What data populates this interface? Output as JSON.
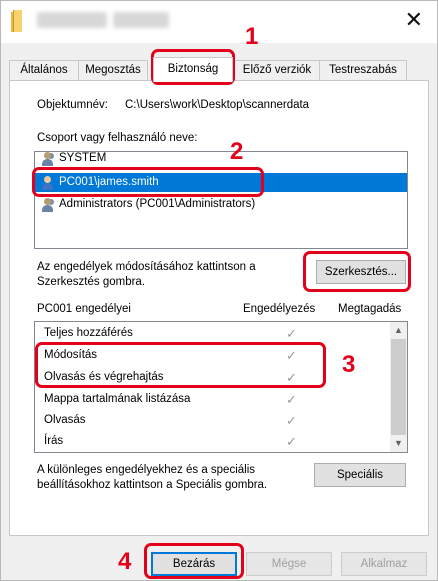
{
  "window": {
    "close_glyph": "✕"
  },
  "tabs": [
    {
      "label": "Általános",
      "active": false
    },
    {
      "label": "Megosztás",
      "active": false
    },
    {
      "label": "Biztonság",
      "active": true
    },
    {
      "label": "Előző verziók",
      "active": false
    },
    {
      "label": "Testreszabás",
      "active": false
    }
  ],
  "object": {
    "label": "Objektumnév:",
    "path": "C:\\Users\\work\\Desktop\\scannerdata"
  },
  "groups": {
    "label": "Csoport vagy felhasználó neve:",
    "items": [
      {
        "name": "SYSTEM",
        "icon": "users-group-icon",
        "selected": false
      },
      {
        "name": "PC001\\james.smith",
        "icon": "user-icon",
        "selected": true
      },
      {
        "name": "Administrators (PC001\\Administrators)",
        "icon": "users-group-icon",
        "selected": false
      }
    ]
  },
  "edit": {
    "hint": "Az engedélyek módosításához kattintson a Szerkesztés gombra.",
    "button": "Szerkesztés..."
  },
  "permissions": {
    "header": "PC001 engedélyei",
    "allow_col": "Engedélyezés",
    "deny_col": "Megtagadás",
    "rows": [
      {
        "name": "Teljes hozzáférés",
        "allow": true,
        "deny": false
      },
      {
        "name": "Módosítás",
        "allow": true,
        "deny": false
      },
      {
        "name": "Olvasás és végrehajtás",
        "allow": true,
        "deny": false
      },
      {
        "name": "Mappa tartalmának listázása",
        "allow": true,
        "deny": false
      },
      {
        "name": "Olvasás",
        "allow": true,
        "deny": false
      },
      {
        "name": "Írás",
        "allow": true,
        "deny": false
      }
    ],
    "check_glyph": "✓"
  },
  "special": {
    "hint": "A különleges engedélyekhez és a speciális beállításokhoz kattintson a Speciális gombra.",
    "button": "Speciális"
  },
  "footer": {
    "close": "Bezárás",
    "cancel": "Mégse",
    "apply": "Alkalmaz"
  },
  "annotations": [
    "1",
    "2",
    "3",
    "4"
  ],
  "colors": {
    "annotation": "#e3001b",
    "selection": "#0078d7"
  }
}
